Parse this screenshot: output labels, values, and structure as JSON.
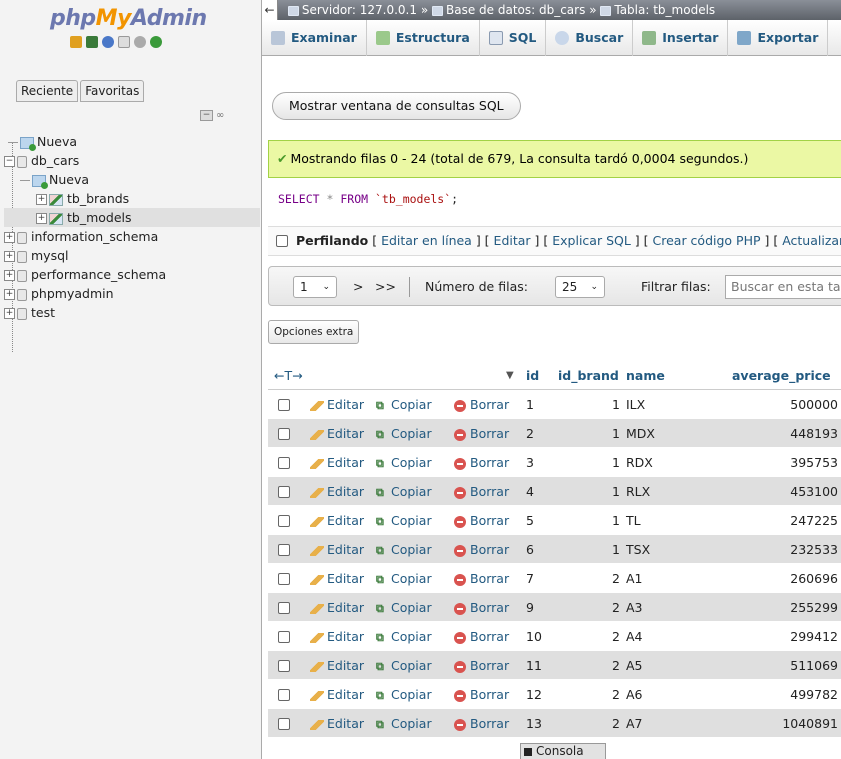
{
  "nav": {
    "logo": {
      "php": "php",
      "my": "My",
      "admin": "Admin"
    },
    "tabs": [
      "Reciente",
      "Favoritas"
    ],
    "tree": {
      "nueva": "Nueva",
      "db_cars": "db_cars",
      "db_cars_nueva": "Nueva",
      "tb_brands": "tb_brands",
      "tb_models": "tb_models",
      "information_schema": "information_schema",
      "mysql": "mysql",
      "performance_schema": "performance_schema",
      "phpmyadmin": "phpmyadmin",
      "test": "test"
    }
  },
  "breadcrumb": {
    "server": "Servidor: 127.0.0.1",
    "database": "Base de datos: db_cars",
    "table": "Tabla: tb_models",
    "separator": "»"
  },
  "menu": [
    "Examinar",
    "Estructura",
    "SQL",
    "Buscar",
    "Insertar",
    "Exportar"
  ],
  "sql_window_button": "Mostrar ventana de consultas SQL",
  "success_message": "Mostrando filas 0 - 24 (total de 679, La consulta tardó 0,0004 segundos.)",
  "sql_query": {
    "select": "SELECT",
    "star": "*",
    "from": "FROM",
    "table": "`tb_models`",
    "end": ";"
  },
  "profiling": {
    "label": "Perfilando",
    "links": [
      "Editar en línea",
      "Editar",
      "Explicar SQL",
      "Crear código PHP",
      "Actualizar"
    ]
  },
  "pagination": {
    "page": "1",
    "next": ">",
    "last": ">>",
    "rows_label": "Número de filas:",
    "rows_value": "25",
    "filter_label": "Filtrar filas:",
    "filter_placeholder": "Buscar en esta tabla"
  },
  "extra_options": "Opciones extra",
  "table": {
    "arrows": "←T→",
    "sort_icon": "▼",
    "columns": [
      "id",
      "id_brand",
      "name",
      "average_price"
    ],
    "action_labels": {
      "edit": "Editar",
      "copy": "Copiar",
      "delete": "Borrar"
    },
    "rows": [
      {
        "id": "1",
        "id_brand": "1",
        "name": "ILX",
        "average_price": "500000"
      },
      {
        "id": "2",
        "id_brand": "1",
        "name": "MDX",
        "average_price": "448193"
      },
      {
        "id": "3",
        "id_brand": "1",
        "name": "RDX",
        "average_price": "395753"
      },
      {
        "id": "4",
        "id_brand": "1",
        "name": "RLX",
        "average_price": "453100"
      },
      {
        "id": "5",
        "id_brand": "1",
        "name": "TL",
        "average_price": "247225"
      },
      {
        "id": "6",
        "id_brand": "1",
        "name": "TSX",
        "average_price": "232533"
      },
      {
        "id": "7",
        "id_brand": "2",
        "name": "A1",
        "average_price": "260696"
      },
      {
        "id": "9",
        "id_brand": "2",
        "name": "A3",
        "average_price": "255299"
      },
      {
        "id": "10",
        "id_brand": "2",
        "name": "A4",
        "average_price": "299412"
      },
      {
        "id": "11",
        "id_brand": "2",
        "name": "A5",
        "average_price": "511069"
      },
      {
        "id": "12",
        "id_brand": "2",
        "name": "A6",
        "average_price": "499782"
      },
      {
        "id": "13",
        "id_brand": "2",
        "name": "A7",
        "average_price": "1040891"
      }
    ]
  },
  "console_label": "Consola",
  "colors": {
    "link": "#235a81",
    "success_bg": "#ebf8a4",
    "row_alt": "#dfdfdf",
    "logo_blue": "#6c78af",
    "logo_orange": "#f29400"
  }
}
